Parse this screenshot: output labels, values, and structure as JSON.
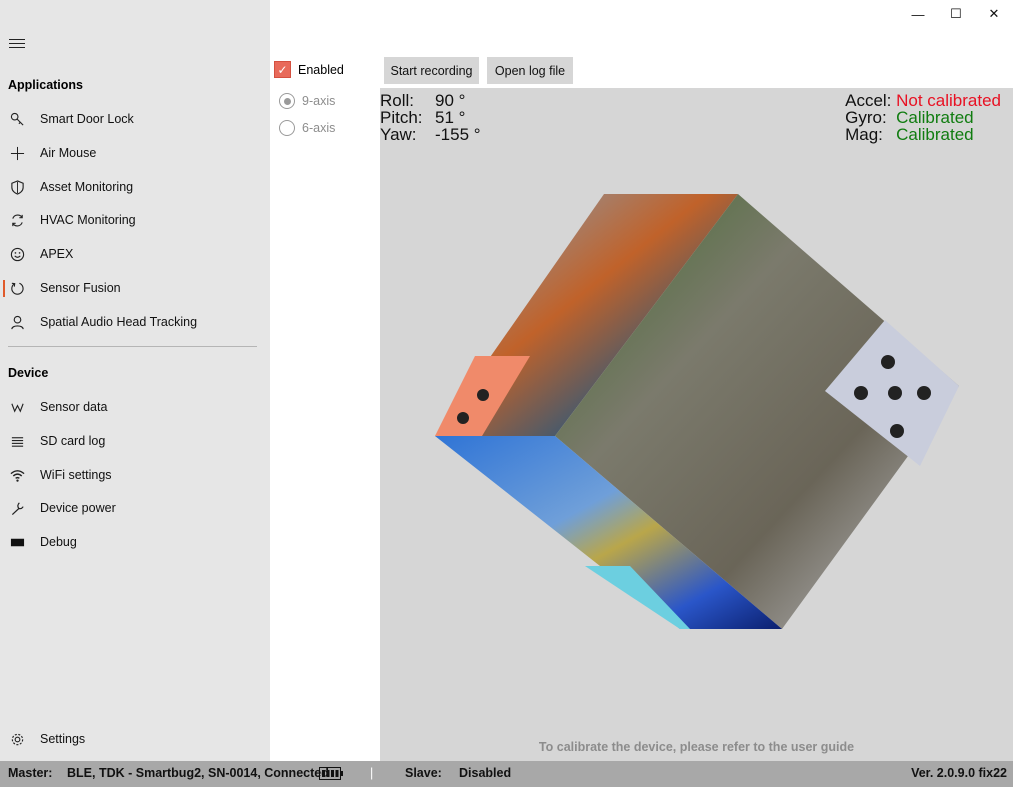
{
  "window_controls": {
    "minimize": "—",
    "maximize": "☐",
    "close": "✕"
  },
  "sidebar": {
    "applications_title": "Applications",
    "applications": [
      {
        "label": "Smart Door Lock",
        "icon": "key-icon"
      },
      {
        "label": "Air Mouse",
        "icon": "move-icon"
      },
      {
        "label": "Asset Monitoring",
        "icon": "shield-icon"
      },
      {
        "label": "HVAC Monitoring",
        "icon": "sync-icon"
      },
      {
        "label": "APEX",
        "icon": "smiley-icon"
      },
      {
        "label": "Sensor Fusion",
        "icon": "refresh-icon"
      },
      {
        "label": "Spatial Audio Head Tracking",
        "icon": "person-icon"
      }
    ],
    "device_title": "Device",
    "device": [
      {
        "label": "Sensor data",
        "icon": "wave-icon"
      },
      {
        "label": "SD card log",
        "icon": "list-icon"
      },
      {
        "label": "WiFi settings",
        "icon": "wifi-icon"
      },
      {
        "label": "Device power",
        "icon": "wrench-icon"
      },
      {
        "label": "Debug",
        "icon": "terminal-icon"
      }
    ],
    "settings_label": "Settings"
  },
  "options": {
    "enabled_label": "Enabled",
    "enabled_checked": true,
    "nine_axis_label": "9-axis",
    "six_axis_label": "6-axis"
  },
  "toolbar": {
    "start_recording": "Start recording",
    "open_log": "Open log file"
  },
  "orientation": {
    "roll_label": "Roll:",
    "roll_value": "90 °",
    "pitch_label": "Pitch:",
    "pitch_value": "51 °",
    "yaw_label": "Yaw:",
    "yaw_value": "-155 °"
  },
  "calibration": {
    "accel_label": "Accel:",
    "accel_value": "Not calibrated",
    "gyro_label": "Gyro:",
    "gyro_value": "Calibrated",
    "mag_label": "Mag:",
    "mag_value": "Calibrated",
    "colors": {
      "not_calibrated": "#e81123",
      "calibrated": "#107c10"
    }
  },
  "hint": "To calibrate the device, please refer to the user guide",
  "status": {
    "master_label": "Master:",
    "master_value": "BLE, TDK - Smartbug2, SN-0014, Connected",
    "separator": "|",
    "slave_label": "Slave:",
    "slave_value": "Disabled",
    "version": "Ver. 2.0.9.0 fix22"
  }
}
